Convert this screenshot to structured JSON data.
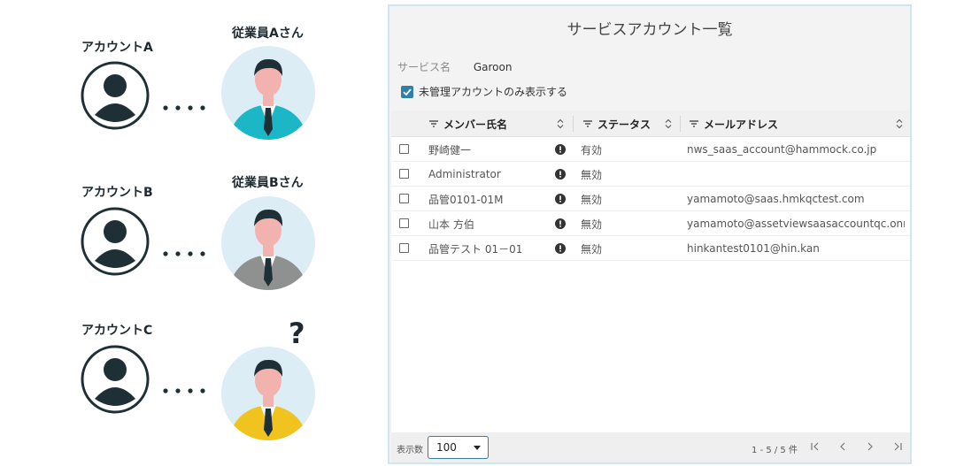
{
  "illustration": {
    "accounts": [
      {
        "label": "アカウントA"
      },
      {
        "label": "アカウントB"
      },
      {
        "label": "アカウントC"
      }
    ],
    "employees": [
      {
        "label": "従業員Aさん",
        "suit_color": "#1bb7c7"
      },
      {
        "label": "従業員Bさん",
        "suit_color": "#8f9191"
      },
      {
        "label": "",
        "suit_color": "#f0c31f"
      }
    ],
    "question_mark": "?"
  },
  "panel": {
    "title": "サービスアカウント一覧",
    "service": {
      "label": "サービス名",
      "value": "Garoon"
    },
    "filter_checkbox": {
      "label": "未管理アカウントのみ表示する",
      "checked": true
    },
    "columns": [
      {
        "label": "メンバー氏名"
      },
      {
        "label": "ステータス"
      },
      {
        "label": "メールアドレス"
      }
    ],
    "rows": [
      {
        "name": "野崎健一",
        "status": "有効",
        "email": "nws_saas_account@hammock.co.jp"
      },
      {
        "name": "Administrator",
        "status": "無効",
        "email": ""
      },
      {
        "name": "品管0101-01M",
        "status": "無効",
        "email": "yamamoto@saas.hmkqctest.com"
      },
      {
        "name": "山本 方伯",
        "status": "無効",
        "email": "yamamoto@assetviewsaasaccountqc.onm⋯"
      },
      {
        "name": "品管テスト 01－01",
        "status": "無効",
        "email": "hinkantest0101@hin.kan"
      }
    ],
    "footer": {
      "display_label": "表示数",
      "page_size": "100",
      "range": "1 - 5 / 5 件"
    },
    "colors": {
      "accent": "#2f7fa6",
      "border": "#cfe6f1"
    }
  }
}
